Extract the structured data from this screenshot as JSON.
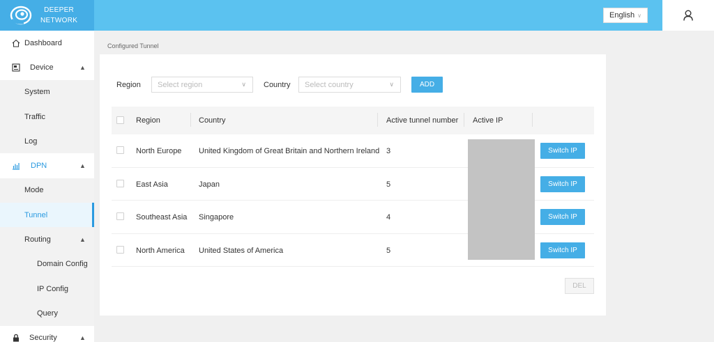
{
  "app": {
    "logo_line1": "DEEPER",
    "logo_line2": "NETWORK",
    "language": "English"
  },
  "colors": {
    "accent": "#45aee6",
    "topbar": "#5bc2f0",
    "active_nav": "#2a9ae0"
  },
  "sidebar": {
    "items": [
      {
        "label": "Dashboard",
        "icon": "home-icon"
      },
      {
        "label": "Device",
        "icon": "device-icon",
        "expanded": true
      },
      {
        "label": "System"
      },
      {
        "label": "Traffic"
      },
      {
        "label": "Log"
      },
      {
        "label": "DPN",
        "icon": "chart-icon",
        "expanded": true
      },
      {
        "label": "Mode"
      },
      {
        "label": "Tunnel",
        "active": true
      },
      {
        "label": "Routing",
        "expanded": true
      },
      {
        "label": "Domain Config"
      },
      {
        "label": "IP Config"
      },
      {
        "label": "Query"
      },
      {
        "label": "Security",
        "icon": "lock-icon",
        "expanded": true
      }
    ]
  },
  "page": {
    "breadcrumb": "Configured Tunnel",
    "filters": {
      "region_label": "Region",
      "region_placeholder": "Select region",
      "country_label": "Country",
      "country_placeholder": "Select country",
      "add_label": "ADD"
    },
    "table": {
      "columns": [
        "Region",
        "Country",
        "Active tunnel number",
        "Active IP"
      ],
      "rows": [
        {
          "region": "North Europe",
          "country": "United Kingdom of Great Britain and Northern Ireland",
          "active": "3",
          "action": "Switch IP"
        },
        {
          "region": "East Asia",
          "country": "Japan",
          "active": "5",
          "action": "Switch IP"
        },
        {
          "region": "Southeast Asia",
          "country": "Singapore",
          "active": "4",
          "action": "Switch IP"
        },
        {
          "region": "North America",
          "country": "United States of America",
          "active": "5",
          "action": "Switch IP"
        }
      ]
    },
    "del_label": "DEL"
  }
}
